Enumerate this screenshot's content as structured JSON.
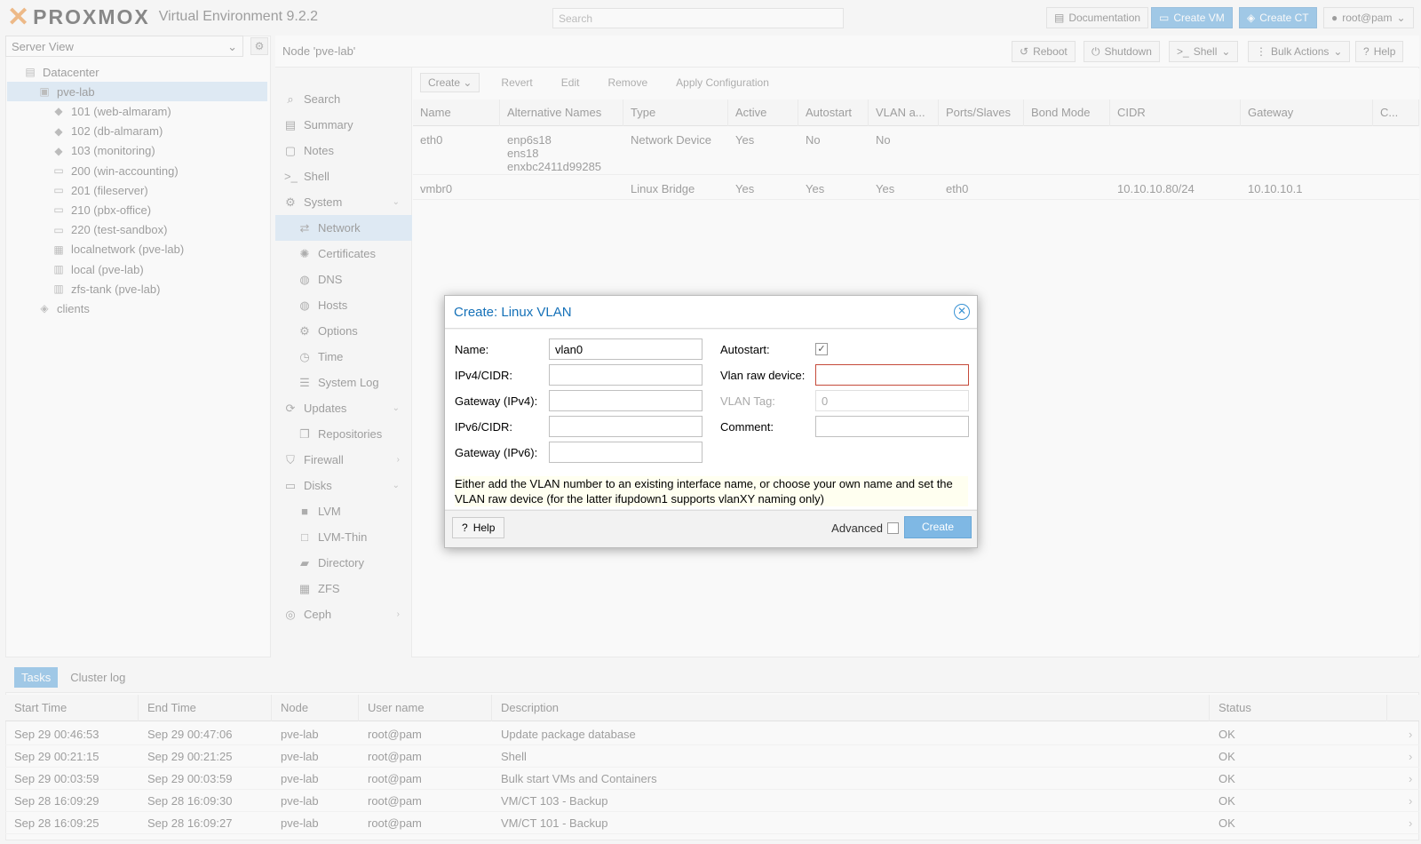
{
  "topbar": {
    "logo_text": "PROXMOX",
    "version": "Virtual Environment 9.2.2",
    "search_placeholder": "Search",
    "buttons": {
      "documentation": "Documentation",
      "create_vm": "Create VM",
      "create_ct": "Create CT",
      "user": "root@pam"
    }
  },
  "tree": {
    "view_select": "Server View",
    "items": [
      {
        "label": "Datacenter",
        "icon": "datacenter-icon"
      },
      {
        "label": "pve-lab",
        "icon": "node-icon"
      },
      {
        "label": "101 (web-almaram)",
        "icon": "container-icon"
      },
      {
        "label": "102 (db-almaram)",
        "icon": "container-icon"
      },
      {
        "label": "103 (monitoring)",
        "icon": "container-icon"
      },
      {
        "label": "200 (win-accounting)",
        "icon": "vm-icon"
      },
      {
        "label": "201 (fileserver)",
        "icon": "vm-icon"
      },
      {
        "label": "210 (pbx-office)",
        "icon": "vm-icon"
      },
      {
        "label": "220 (test-sandbox)",
        "icon": "vm-icon"
      },
      {
        "label": "localnetwork (pve-lab)",
        "icon": "network-grid-icon"
      },
      {
        "label": "local (pve-lab)",
        "icon": "storage-icon"
      },
      {
        "label": "zfs-tank (pve-lab)",
        "icon": "storage-icon"
      },
      {
        "label": "clients",
        "icon": "tag-icon"
      }
    ]
  },
  "node_header": {
    "title": "Node 'pve-lab'",
    "buttons": {
      "reboot": "Reboot",
      "shutdown": "Shutdown",
      "shell": "Shell",
      "bulk_actions": "Bulk Actions",
      "help": "Help"
    }
  },
  "nav": {
    "items": [
      {
        "label": "Search",
        "icon": "search-icon"
      },
      {
        "label": "Summary",
        "icon": "book-icon"
      },
      {
        "label": "Notes",
        "icon": "notes-icon"
      },
      {
        "label": "Shell",
        "icon": "terminal-icon"
      },
      {
        "label": "System",
        "icon": "gears-icon"
      },
      {
        "label": "Network",
        "icon": "exchange-icon"
      },
      {
        "label": "Certificates",
        "icon": "certificate-icon"
      },
      {
        "label": "DNS",
        "icon": "globe-icon"
      },
      {
        "label": "Hosts",
        "icon": "globe-icon"
      },
      {
        "label": "Options",
        "icon": "gear-icon"
      },
      {
        "label": "Time",
        "icon": "clock-icon"
      },
      {
        "label": "System Log",
        "icon": "list-icon"
      },
      {
        "label": "Updates",
        "icon": "refresh-icon"
      },
      {
        "label": "Repositories",
        "icon": "files-icon"
      },
      {
        "label": "Firewall",
        "icon": "shield-icon"
      },
      {
        "label": "Disks",
        "icon": "hdd-icon"
      },
      {
        "label": "LVM",
        "icon": "square-icon"
      },
      {
        "label": "LVM-Thin",
        "icon": "square-outline-icon"
      },
      {
        "label": "Directory",
        "icon": "folder-icon"
      },
      {
        "label": "ZFS",
        "icon": "grid-icon"
      },
      {
        "label": "Ceph",
        "icon": "ceph-icon"
      }
    ]
  },
  "network_toolbar": {
    "create": "Create",
    "revert": "Revert",
    "edit": "Edit",
    "remove": "Remove",
    "apply": "Apply Configuration"
  },
  "network_table": {
    "columns": [
      "Name",
      "Alternative Names",
      "Type",
      "Active",
      "Autostart",
      "VLAN a...",
      "Ports/Slaves",
      "Bond Mode",
      "CIDR",
      "Gateway",
      "C..."
    ],
    "rows": [
      {
        "name": "eth0",
        "alt": [
          "enp6s18",
          "ens18",
          "enxbc2411d99285"
        ],
        "type": "Network Device",
        "active": "Yes",
        "autostart": "No",
        "vlan": "No",
        "ports": "",
        "bond": "",
        "cidr": "",
        "gateway": ""
      },
      {
        "name": "vmbr0",
        "alt": [],
        "type": "Linux Bridge",
        "active": "Yes",
        "autostart": "Yes",
        "vlan": "Yes",
        "ports": "eth0",
        "bond": "",
        "cidr": "10.10.10.80/24",
        "gateway": "10.10.10.1"
      }
    ]
  },
  "tasks": {
    "tabs": [
      "Tasks",
      "Cluster log"
    ],
    "columns": [
      "Start Time",
      "End Time",
      "Node",
      "User name",
      "Description",
      "Status"
    ],
    "rows": [
      {
        "start": "Sep 29 00:46:53",
        "end": "Sep 29 00:47:06",
        "node": "pve-lab",
        "user": "root@pam",
        "desc": "Update package database",
        "status": "OK"
      },
      {
        "start": "Sep 29 00:21:15",
        "end": "Sep 29 00:21:25",
        "node": "pve-lab",
        "user": "root@pam",
        "desc": "Shell",
        "status": "OK"
      },
      {
        "start": "Sep 29 00:03:59",
        "end": "Sep 29 00:03:59",
        "node": "pve-lab",
        "user": "root@pam",
        "desc": "Bulk start VMs and Containers",
        "status": "OK"
      },
      {
        "start": "Sep 28 16:09:29",
        "end": "Sep 28 16:09:30",
        "node": "pve-lab",
        "user": "root@pam",
        "desc": "VM/CT 103 - Backup",
        "status": "OK"
      },
      {
        "start": "Sep 28 16:09:25",
        "end": "Sep 28 16:09:27",
        "node": "pve-lab",
        "user": "root@pam",
        "desc": "VM/CT 101 - Backup",
        "status": "OK"
      }
    ]
  },
  "dialog": {
    "title": "Create: Linux VLAN",
    "fields": {
      "name_label": "Name:",
      "name_value": "vlan0",
      "ipv4_label": "IPv4/CIDR:",
      "gw4_label": "Gateway (IPv4):",
      "ipv6_label": "IPv6/CIDR:",
      "gw6_label": "Gateway (IPv6):",
      "autostart_label": "Autostart:",
      "raw_label": "Vlan raw device:",
      "tag_label": "VLAN Tag:",
      "tag_value": "0",
      "comment_label": "Comment:"
    },
    "hint": "Either add the VLAN number to an existing interface name, or choose your own name and set the VLAN raw device (for the latter ifupdown1 supports vlanXY naming only)",
    "help": "Help",
    "advanced": "Advanced",
    "create": "Create"
  }
}
